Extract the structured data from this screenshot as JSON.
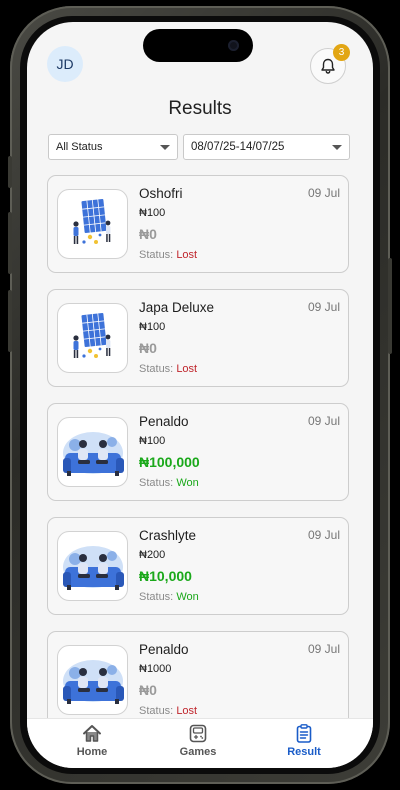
{
  "header": {
    "avatar_initials": "JD",
    "notification_count": "3"
  },
  "page": {
    "title": "Results"
  },
  "filters": {
    "status_value": "All Status",
    "date_range_value": "08/07/25-14/07/25"
  },
  "results": [
    {
      "game": "Oshofri",
      "date": "09 Jul",
      "stake": "₦100",
      "payout": "₦0",
      "status_label": "Status:",
      "status": "Lost",
      "thumbnail_icon": "board-strategy-illustration"
    },
    {
      "game": "Japa Deluxe",
      "date": "09 Jul",
      "stake": "₦100",
      "payout": "₦0",
      "status_label": "Status:",
      "status": "Lost",
      "thumbnail_icon": "board-strategy-illustration"
    },
    {
      "game": "Penaldo",
      "date": "09 Jul",
      "stake": "₦100",
      "payout": "₦100,000",
      "status_label": "Status:",
      "status": "Won",
      "thumbnail_icon": "gamers-on-couch-illustration"
    },
    {
      "game": "Crashlyte",
      "date": "09 Jul",
      "stake": "₦200",
      "payout": "₦10,000",
      "status_label": "Status:",
      "status": "Won",
      "thumbnail_icon": "gamers-on-couch-illustration"
    },
    {
      "game": "Penaldo",
      "date": "09 Jul",
      "stake": "₦1000",
      "payout": "₦0",
      "status_label": "Status:",
      "status": "Lost",
      "thumbnail_icon": "gamers-on-couch-illustration"
    }
  ],
  "nav": {
    "home": "Home",
    "games": "Games",
    "result": "Result",
    "active": "result"
  },
  "colors": {
    "won": "#1aa81a",
    "lost": "#c0262d",
    "accent": "#1a5cc8",
    "badge": "#e2a614"
  }
}
